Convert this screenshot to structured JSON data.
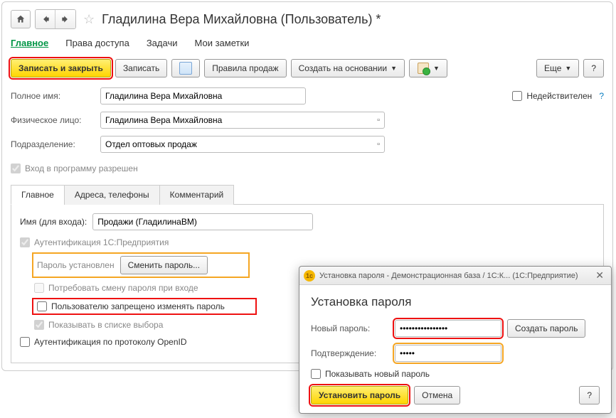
{
  "colors": {
    "accent": "#009646",
    "primary_btn": "#ffd400",
    "hl_red": "#e11",
    "hl_orange": "#f5a623"
  },
  "window_title": "Гладилина Вера Михайловна (Пользователь) *",
  "top_tabs": [
    {
      "label": "Главное",
      "active": true
    },
    {
      "label": "Права доступа",
      "active": false
    },
    {
      "label": "Задачи",
      "active": false
    },
    {
      "label": "Мои заметки",
      "active": false
    }
  ],
  "toolbar": {
    "save_close": "Записать и закрыть",
    "save": "Записать",
    "rules": "Правила продаж",
    "create_on": "Создать на основании",
    "more": "Еще",
    "help": "?"
  },
  "fields": {
    "fullname_label": "Полное имя:",
    "fullname_value": "Гладилина Вера Михайловна",
    "inactive_label": "Недействителен",
    "person_label": "Физическое лицо:",
    "person_value": "Гладилина Вера Михайловна",
    "dept_label": "Подразделение:",
    "dept_value": "Отдел оптовых продаж",
    "login_allowed_label": "Вход в программу разрешен"
  },
  "inner_tabs": [
    {
      "label": "Главное",
      "active": true
    },
    {
      "label": "Адреса, телефоны",
      "active": false
    },
    {
      "label": "Комментарий",
      "active": false
    }
  ],
  "login": {
    "login_label": "Имя (для входа):",
    "login_value": "Продажи (ГладилинаВМ)",
    "auth1c_label": "Аутентификация 1С:Предприятия",
    "pwd_status_label": "Пароль установлен",
    "change_pwd_btn": "Сменить пароль...",
    "require_change_label": "Потребовать смену пароля при входе",
    "forbid_change_label": "Пользователю запрещено изменять пароль",
    "show_in_select_label": "Показывать в списке выбора",
    "auth_openid_label": "Аутентификация по протоколу OpenID"
  },
  "dialog": {
    "titlebar": "Установка пароля - Демонстрационная база / 1С:К...  (1С:Предприятие)",
    "heading": "Установка пароля",
    "new_pwd_label": "Новый пароль:",
    "new_pwd_value": "****************",
    "confirm_label": "Подтверждение:",
    "confirm_value": "*****",
    "gen_pwd_btn": "Создать пароль",
    "show_pwd_label": "Показывать новый пароль",
    "set_btn": "Установить пароль",
    "cancel_btn": "Отмена",
    "help": "?"
  }
}
